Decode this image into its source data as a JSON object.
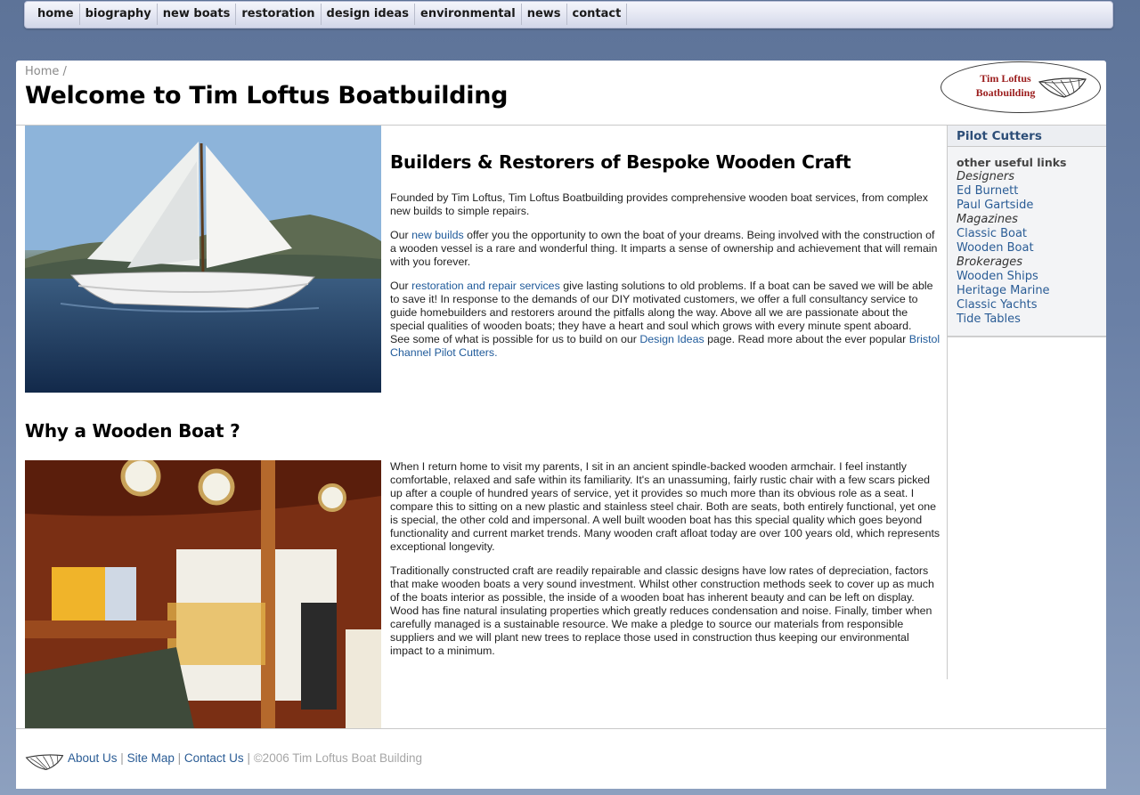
{
  "nav": {
    "items": [
      "home",
      "biography",
      "new boats",
      "restoration",
      "design ideas",
      "environmental",
      "news",
      "contact"
    ]
  },
  "header": {
    "breadcrumb_home": "Home",
    "breadcrumb_sep": "/",
    "title": "Welcome to Tim Loftus Boatbuilding",
    "logo_line1": "Tim Loftus",
    "logo_line2": "Boatbuilding"
  },
  "main": {
    "heading1": "Builders & Restorers of Bespoke Wooden Craft",
    "p1": "Founded by Tim Loftus, Tim Loftus Boatbuilding provides comprehensive wooden boat services, from complex new builds to simple repairs.",
    "p2_pre": "Our ",
    "p2_link": "new builds",
    "p2_post": " offer you the opportunity to own the boat of your dreams. Being involved with the construction of a wooden vessel is a rare and wonderful thing. It imparts a sense of ownership and achievement that will remain with you forever.",
    "p3_pre": "Our ",
    "p3_link": "restoration and repair services",
    "p3_post": " give lasting solutions to old problems. If a boat can be saved we will be able to save it! In response to the demands of our DIY motivated customers, we offer a full consultancy service to guide homebuilders and restorers around the pitfalls along the way. Above all we are passionate about the special qualities of wooden boats; they have a heart and soul which grows with every minute spent aboard.",
    "p4_pre": "See some of what is possible for us to build on our ",
    "p4_link": "Design Ideas",
    "p4_mid": " page. Read more about the ever popular ",
    "p4_link2": "Bristol Channel Pilot Cutters.",
    "heading2": "Why a Wooden Boat ?",
    "p5": "When I return home to visit my parents, I sit in an ancient spindle-backed wooden armchair. I feel instantly comfortable, relaxed and safe within its familiarity. It's an unassuming, fairly rustic chair with a few scars picked up after a couple of hundred years of service, yet it provides so much more than its obvious role as a seat. I compare this to sitting on a new plastic and stainless steel chair. Both are seats, both entirely functional, yet one is special, the other cold and impersonal. A well built wooden boat has this special quality which goes beyond functionality and current market trends. Many wooden craft afloat today are over 100 years old, which represents exceptional longevity.",
    "p6": "Traditionally constructed craft are readily repairable and classic designs have low rates of depreciation, factors that make wooden boats a very sound investment. Whilst other construction methods seek to cover up as much of the boats interior as possible, the inside of a wooden boat has inherent beauty and can be left on display. Wood has fine natural insulating properties which greatly reduces condensation and noise. Finally, timber when carefully managed is a sustainable resource. We make a pledge to source our materials from responsible suppliers and we will plant new trees to replace those used in construction thus keeping our environmental impact to a minimum."
  },
  "sidebar": {
    "title": "Pilot Cutters",
    "subtitle": "other useful links",
    "items": [
      {
        "label": "Designers",
        "kind": "cat"
      },
      {
        "label": "Ed Burnett",
        "kind": "lnk"
      },
      {
        "label": "Paul Gartside",
        "kind": "lnk"
      },
      {
        "label": "Magazines",
        "kind": "cat"
      },
      {
        "label": "Classic Boat",
        "kind": "lnk"
      },
      {
        "label": "Wooden Boat",
        "kind": "lnk"
      },
      {
        "label": "Brokerages",
        "kind": "cat"
      },
      {
        "label": "Wooden Ships",
        "kind": "lnk"
      },
      {
        "label": "Heritage Marine",
        "kind": "lnk"
      },
      {
        "label": "Classic Yachts",
        "kind": "lnk"
      },
      {
        "label": "Tide Tables",
        "kind": "lnk"
      }
    ]
  },
  "footer": {
    "about": "About Us",
    "sitemap": "Site Map",
    "contact": "Contact Us",
    "sep": "|",
    "copyright": "©2006 Tim Loftus Boat Building"
  },
  "icons": {
    "logo": "boat-hull-icon",
    "footer": "boat-hull-icon"
  }
}
